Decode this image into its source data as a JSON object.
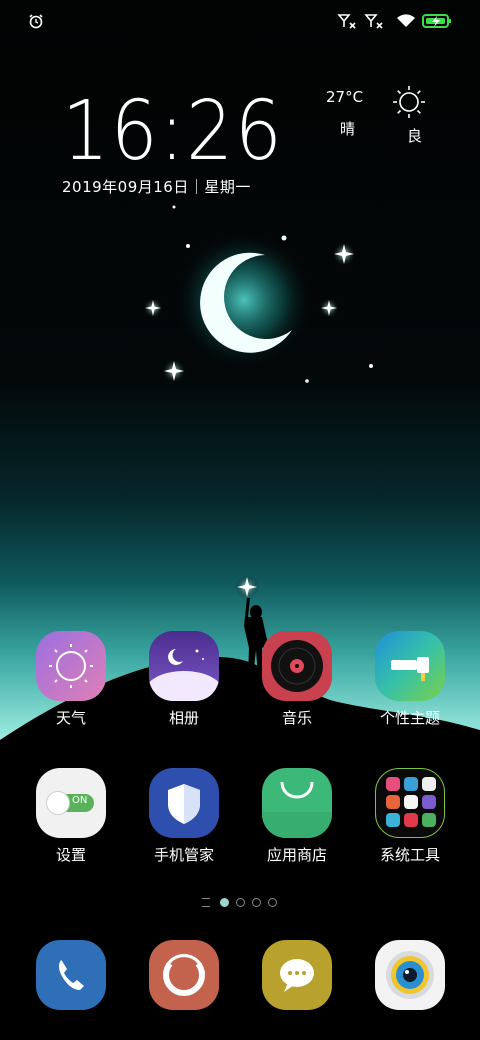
{
  "status_bar": {
    "icons": [
      "alarm-icon",
      "signal-1-no-sim-icon",
      "signal-2-no-sim-icon",
      "wifi-icon",
      "battery-charging-icon"
    ],
    "battery_color": "#3ddc4a"
  },
  "clock": {
    "time": "16:26",
    "date": "2019年09月16日｜星期一"
  },
  "weather": {
    "temperature": "27°C",
    "condition": "晴",
    "air_quality": "良",
    "icon": "sun-icon"
  },
  "home": {
    "row1": [
      {
        "label": "天气",
        "icon": "weather-app-icon"
      },
      {
        "label": "相册",
        "icon": "gallery-app-icon"
      },
      {
        "label": "音乐",
        "icon": "music-app-icon"
      },
      {
        "label": "个性主题",
        "icon": "theme-app-icon"
      }
    ],
    "row2": [
      {
        "label": "设置",
        "icon": "settings-app-icon",
        "toggle_text": "ON"
      },
      {
        "label": "手机管家",
        "icon": "phone-manager-app-icon"
      },
      {
        "label": "应用商店",
        "icon": "app-store-app-icon"
      },
      {
        "label": "系统工具",
        "icon": "system-tools-folder-icon"
      }
    ]
  },
  "page_indicator": {
    "pages": 4,
    "current": 1
  },
  "dock": [
    {
      "icon": "phone-app-icon"
    },
    {
      "icon": "browser-app-icon"
    },
    {
      "icon": "messages-app-icon"
    },
    {
      "icon": "camera-app-icon"
    }
  ],
  "colors": {
    "accent_teal": "#2ec5b8",
    "music_red": "#c9404e",
    "store_green": "#3cb878",
    "dock_phone_blue": "#2e6fb8"
  }
}
